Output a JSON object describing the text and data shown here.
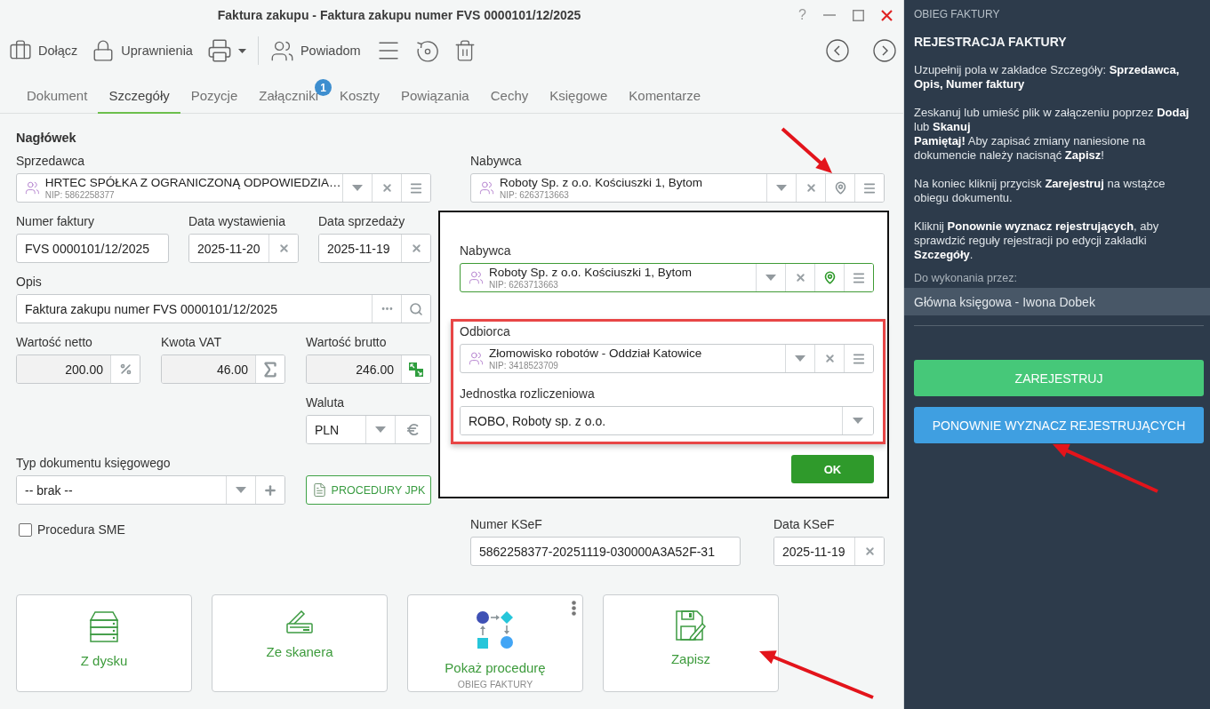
{
  "window": {
    "title": "Faktura zakupu - Faktura zakupu numer FVS 0000101/12/2025",
    "help": "?"
  },
  "toolbar": {
    "attach": "Dołącz",
    "permissions": "Uprawnienia",
    "notify": "Powiadom"
  },
  "tabs": [
    {
      "label": "Dokument",
      "selected": false
    },
    {
      "label": "Szczegóły",
      "selected": true
    },
    {
      "label": "Pozycje",
      "selected": false
    },
    {
      "label": "Załączniki",
      "selected": false,
      "badge": "1"
    },
    {
      "label": "Koszty",
      "selected": false
    },
    {
      "label": "Powiązania",
      "selected": false
    },
    {
      "label": "Cechy",
      "selected": false
    },
    {
      "label": "Księgowe",
      "selected": false
    },
    {
      "label": "Komentarze",
      "selected": false
    }
  ],
  "form": {
    "section_title": "Nagłówek",
    "seller": {
      "label": "Sprzedawca",
      "name": "HRTEC SPÓŁKA Z OGRANICZONĄ ODPOWIEDZIA…",
      "nip": "NIP: 5862258377"
    },
    "buyer": {
      "label": "Nabywca",
      "name": "Roboty Sp. z o.o. Kościuszki 1, Bytom",
      "nip": "NIP: 6263713663",
      "active": false
    },
    "invoice_number": {
      "label": "Numer faktury",
      "value": "FVS 0000101/12/2025"
    },
    "issue_date": {
      "label": "Data wystawienia",
      "value": "2025-11-20"
    },
    "sale_date": {
      "label": "Data sprzedaży",
      "value": "2025-11-19"
    },
    "description": {
      "label": "Opis",
      "value": "Faktura zakupu numer FVS 0000101/12/2025"
    },
    "net_value": {
      "label": "Wartość netto",
      "value": "200.00"
    },
    "vat_amount": {
      "label": "Kwota VAT",
      "value": "46.00"
    },
    "gross_value": {
      "label": "Wartość brutto",
      "value": "246.00"
    },
    "currency": {
      "label": "Waluta",
      "value": "PLN"
    },
    "document_type": {
      "label": "Typ dokumentu księgowego",
      "value": "-- brak --"
    },
    "jpk_button": "PROCEDURY JPK",
    "sme_procedure": {
      "label": "Procedura SME",
      "checked": false
    },
    "ksef_number": {
      "label": "Numer KSeF",
      "value": "5862258377-20251119-030000A3A52F-31"
    },
    "ksef_date": {
      "label": "Data KSeF",
      "value": "2025-11-19"
    }
  },
  "popup": {
    "buyer": {
      "label": "Nabywca",
      "name": "Roboty Sp. z o.o. Kościuszki 1, Bytom",
      "nip": "NIP: 6263713663",
      "active": true
    },
    "recipient": {
      "label": "Odbiorca",
      "name": "Złomowisko robotów - Oddział Katowice",
      "nip": "NIP: 3418523709"
    },
    "settlement_unit": {
      "label": "Jednostka rozliczeniowa",
      "value": "ROBO, Roboty sp. z o.o."
    },
    "ok_button": "OK"
  },
  "tiles": [
    {
      "kind": "disk",
      "label": "Z dysku"
    },
    {
      "kind": "scanner",
      "label": "Ze skanera"
    },
    {
      "kind": "procedure",
      "label": "Pokaż procedurę",
      "caption": "OBIEG FAKTURY"
    },
    {
      "kind": "save",
      "label": "Zapisz"
    }
  ],
  "side_panel": {
    "header": "OBIEG FAKTURY",
    "title": "REJESTRACJA FAKTURY",
    "paragraphs": [
      [
        "Uzupełnij pola w zakładce Szczegóły: **Sprzedawca, Opis, Numer faktury**"
      ],
      [
        "Zeskanuj lub umieść plik w załączeniu poprzez **Dodaj** lub **Skanuj**",
        "**Pamiętaj!** Aby zapisać zmiany naniesione na dokumencie należy nacisnąć **Zapisz**!"
      ],
      [
        "Na koniec kliknij przycisk **Zarejestruj** na wstążce obiegu dokumentu."
      ],
      [
        "Kliknij **Ponownie wyznacz rejestrujących**, aby sprawdzić reguły rejestracji po edycji zakładki **Szczegóły**."
      ]
    ],
    "assignee_label": "Do wykonania przez:",
    "assignee": "Główna księgowa - Iwona Dobek",
    "buttons": [
      {
        "kind": "primary",
        "label": "ZAREJESTRUJ"
      },
      {
        "kind": "secondary",
        "label": "PONOWNIE WYZNACZ REJESTRUJĄCYCH"
      }
    ]
  }
}
